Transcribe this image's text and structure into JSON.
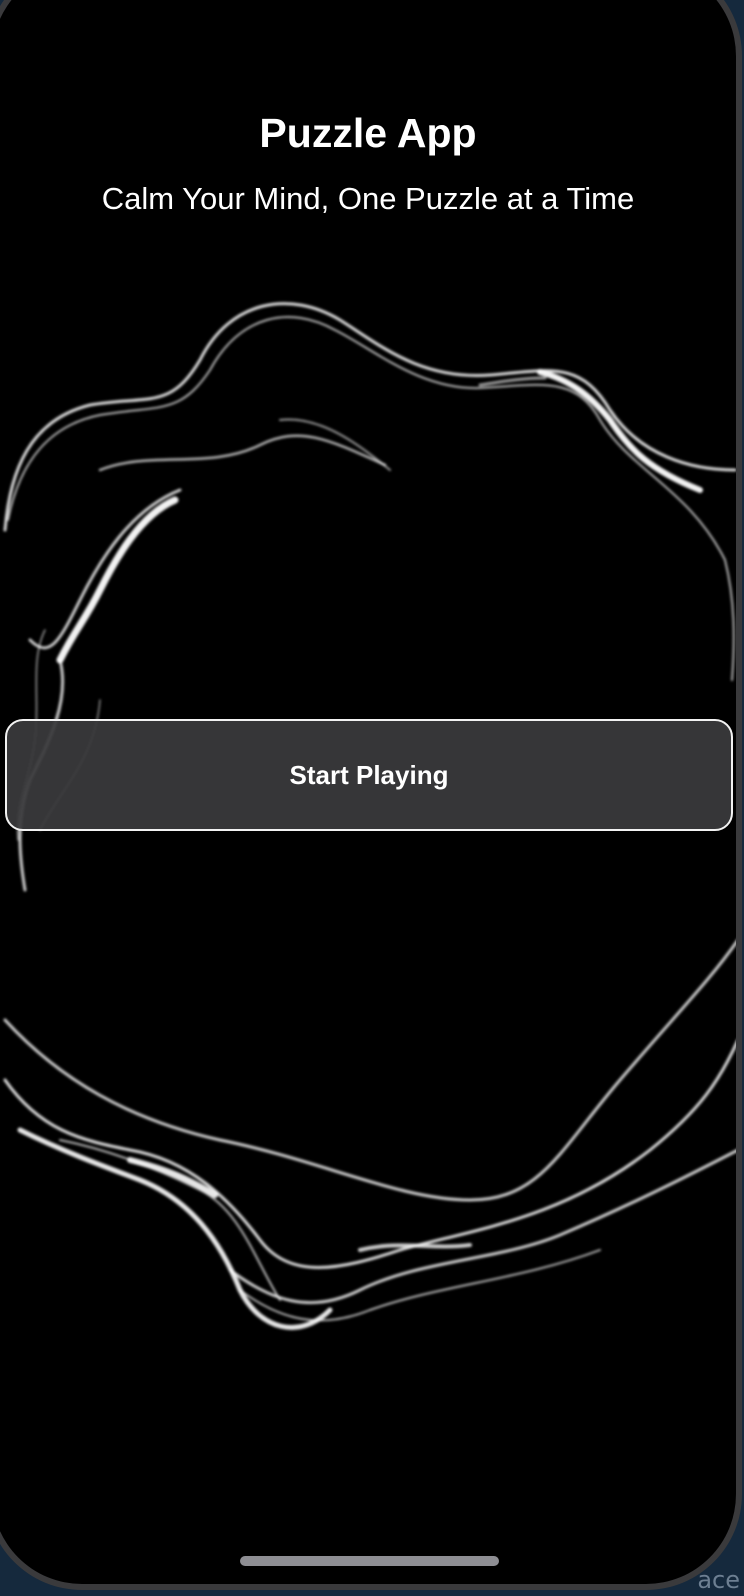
{
  "app": {
    "title": "Puzzle App",
    "subtitle": "Calm Your Mind, One Puzzle at a Time",
    "start_button_label": "Start Playing"
  },
  "background_text": "ace",
  "colors": {
    "background": "#000000",
    "text": "#ffffff",
    "button_fill": "#3a3a3c",
    "button_border": "#f2f2f2"
  }
}
